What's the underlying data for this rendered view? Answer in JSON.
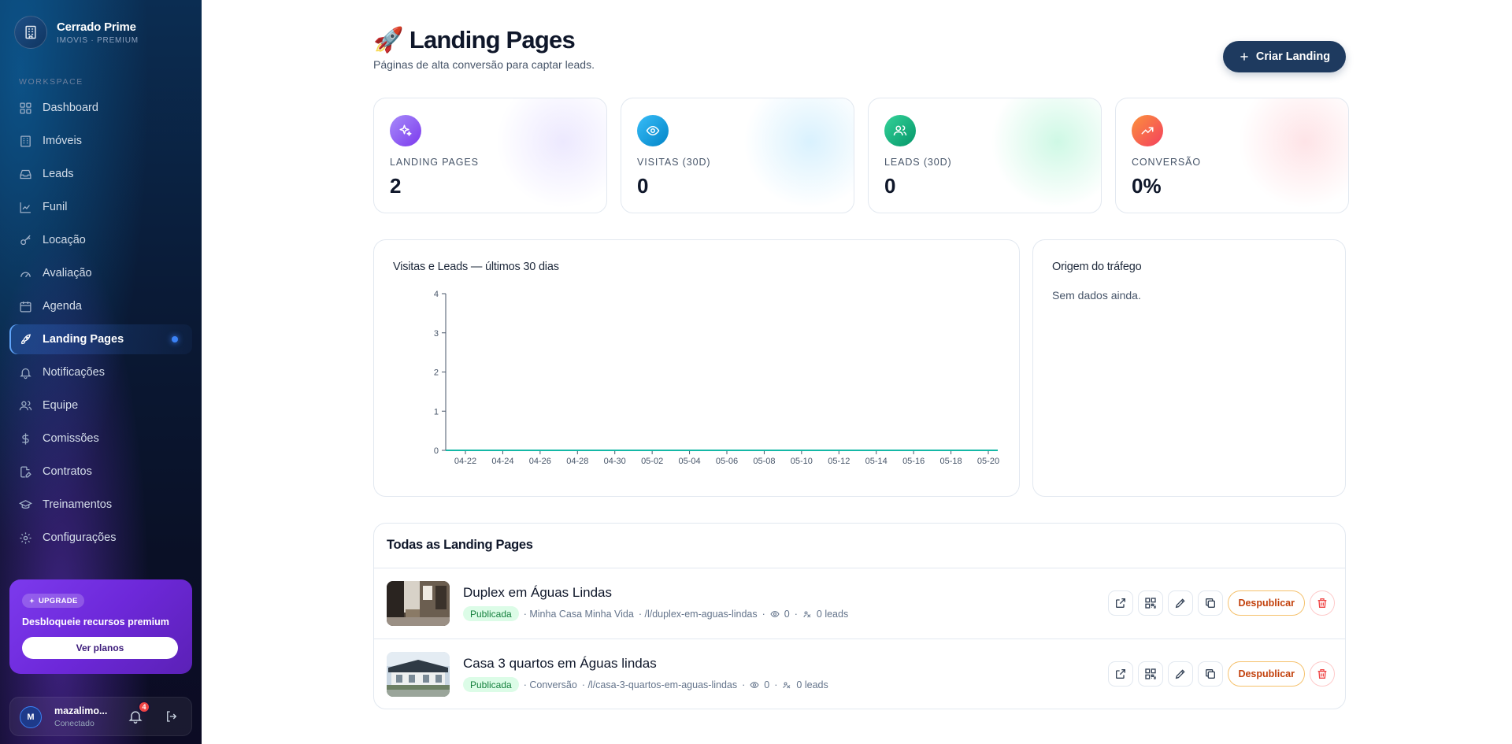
{
  "brand": {
    "name": "Cerrado Prime",
    "subtitle": "IMOVIS · PREMIUM",
    "logo_icon": "building-icon"
  },
  "sidebar": {
    "section_label": "WORKSPACE",
    "items": [
      {
        "label": "Dashboard",
        "icon": "grid-icon"
      },
      {
        "label": "Imóveis",
        "icon": "building-icon"
      },
      {
        "label": "Leads",
        "icon": "inbox-icon"
      },
      {
        "label": "Funil",
        "icon": "chart-line-icon"
      },
      {
        "label": "Locação",
        "icon": "key-icon"
      },
      {
        "label": "Avaliação",
        "icon": "gauge-icon"
      },
      {
        "label": "Agenda",
        "icon": "calendar-icon"
      },
      {
        "label": "Landing Pages",
        "icon": "rocket-icon",
        "active": true
      },
      {
        "label": "Notificações",
        "icon": "bell-icon"
      },
      {
        "label": "Equipe",
        "icon": "users-icon"
      },
      {
        "label": "Comissões",
        "icon": "dollar-icon"
      },
      {
        "label": "Contratos",
        "icon": "file-edit-icon"
      },
      {
        "label": "Treinamentos",
        "icon": "graduation-cap-icon"
      },
      {
        "label": "Configurações",
        "icon": "gear-icon"
      }
    ],
    "upgrade": {
      "badge": "UPGRADE",
      "title": "Desbloqueie recursos premium",
      "button": "Ver planos"
    },
    "user": {
      "initial": "M",
      "name": "mazalimo...",
      "status": "Conectado",
      "notifications": "4"
    }
  },
  "header": {
    "emoji": "🚀",
    "title": "Landing Pages",
    "subtitle": "Páginas de alta conversão para captar leads.",
    "cta": "Criar Landing"
  },
  "stats": [
    {
      "label": "LANDING PAGES",
      "value": "2",
      "icon": "sparkles-icon",
      "color": "#8b5cf6"
    },
    {
      "label": "VISITAS (30D)",
      "value": "0",
      "icon": "eye-icon",
      "color": "#0ea5e9"
    },
    {
      "label": "LEADS (30D)",
      "value": "0",
      "icon": "users-icon",
      "color": "#10b981"
    },
    {
      "label": "CONVERSÃO",
      "value": "0%",
      "icon": "trending-up-icon",
      "color": "#f43f5e"
    }
  ],
  "chart_panel": {
    "title": "Visitas e Leads — últimos 30 dias"
  },
  "chart_data": {
    "type": "line",
    "title": "Visitas e Leads — últimos 30 dias",
    "x_ticks": [
      "04-22",
      "04-24",
      "04-26",
      "04-28",
      "04-30",
      "05-02",
      "05-04",
      "05-06",
      "05-08",
      "05-10",
      "05-12",
      "05-14",
      "05-16",
      "05-18",
      "05-20"
    ],
    "y_ticks": [
      0,
      1,
      2,
      3,
      4
    ],
    "ylim": [
      0,
      4
    ],
    "series": [
      {
        "values": [
          0,
          0,
          0,
          0,
          0,
          0,
          0,
          0,
          0,
          0,
          0,
          0,
          0,
          0,
          0
        ],
        "color": "#14b8a6"
      }
    ]
  },
  "traffic_panel": {
    "title": "Origem do tráfego",
    "empty": "Sem dados ainda."
  },
  "list": {
    "title": "Todas as Landing Pages",
    "rows": [
      {
        "title": "Duplex em Águas Lindas",
        "status": "Publicada",
        "type": "· Minha Casa Minha Vida",
        "slug": "· /l/duplex-em-aguas-lindas",
        "views": "0",
        "leads": "0 leads",
        "unpublish": "Despublicar"
      },
      {
        "title": "Casa 3 quartos em Águas lindas",
        "status": "Publicada",
        "type": "· Conversão",
        "slug": "· /l/casa-3-quartos-em-aguas-lindas",
        "views": "0",
        "leads": "0 leads",
        "unpublish": "Despublicar"
      }
    ]
  }
}
